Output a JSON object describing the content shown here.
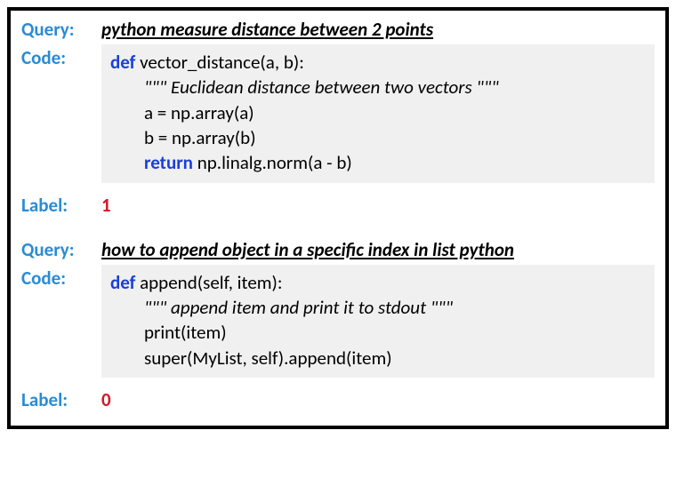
{
  "labels": {
    "query": "Query:",
    "code": "Code:",
    "label": "Label:"
  },
  "examples": [
    {
      "query": "python measure distance between 2 points",
      "code": {
        "def_kw": "def",
        "signature": " vector_distance(a, b):",
        "docstring": "\"\"\" Euclidean distance between two vectors \"\"\"",
        "line_a": "a = np.array(a)",
        "line_b": "b = np.array(b)",
        "return_kw": "return",
        "return_rest": " np.linalg.norm(a - b)"
      },
      "label": "1"
    },
    {
      "query": "how to append object in a specific index in list python",
      "code": {
        "def_kw": "def",
        "signature": " append(self, item):",
        "docstring": "\"\"\" append item and print it to stdout \"\"\"",
        "line_a": "print(item)",
        "line_b": "super(MyList, self).append(item)"
      },
      "label": "0"
    }
  ]
}
